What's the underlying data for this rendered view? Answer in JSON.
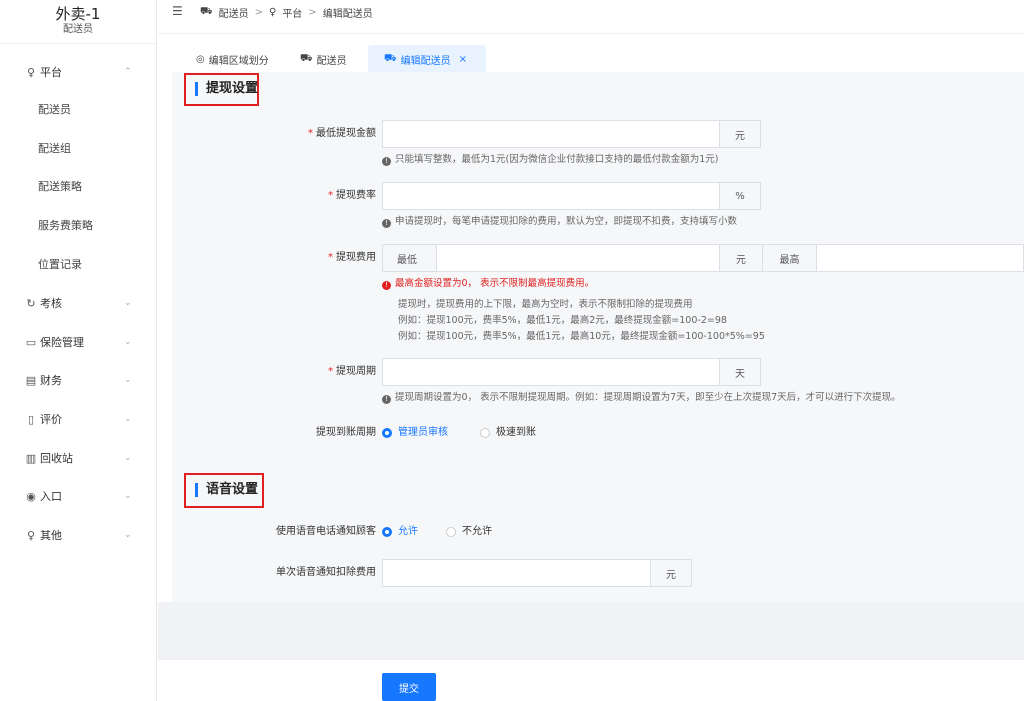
{
  "brand": {
    "title": "外卖-1",
    "subtitle": "配送员"
  },
  "sidebar": {
    "groups": [
      {
        "label": "平台",
        "icon": "people-icon",
        "glyph": "♀",
        "chev": "⌃"
      },
      {
        "label": "考核",
        "icon": "sync-icon",
        "glyph": "↻",
        "chev": "⌄"
      },
      {
        "label": "保险管理",
        "icon": "monitor-icon",
        "glyph": "▭",
        "chev": "⌄"
      },
      {
        "label": "财务",
        "icon": "ledger-icon",
        "glyph": "▤",
        "chev": "⌄"
      },
      {
        "label": "评价",
        "icon": "document-icon",
        "glyph": "▯",
        "chev": "⌄"
      },
      {
        "label": "回收站",
        "icon": "trash-icon",
        "glyph": "▥",
        "chev": "⌄"
      },
      {
        "label": "入口",
        "icon": "target-icon",
        "glyph": "◉",
        "chev": "⌄"
      },
      {
        "label": "其他",
        "icon": "user-icon",
        "glyph": "♀",
        "chev": "⌄"
      }
    ],
    "subitems": [
      "配送员",
      "配送组",
      "配送策略",
      "服务费策略",
      "位置记录"
    ]
  },
  "topbar": {
    "fold_glyph": "☰",
    "crumbs": [
      "配送员",
      "平台",
      "编辑配送员"
    ]
  },
  "tabs": [
    {
      "label": "编辑区域划分",
      "glyph": "◎"
    },
    {
      "label": "配送员",
      "glyph": "⛟"
    },
    {
      "label": "编辑配送员",
      "glyph": "⛟",
      "close": "×"
    }
  ],
  "withdraw": {
    "title": "提现设置",
    "min_amount": {
      "label": "最低提现金额",
      "unit": "元",
      "hint": "只能填写整数，最低为1元(因为微信企业付款接口支持的最低付款金额为1元)"
    },
    "fee_rate": {
      "label": "提现费率",
      "unit": "%",
      "hint": "申请提现时，每笔申请提现扣除的费用，默认为空，即提现不扣费，支持填写小数"
    },
    "fee": {
      "label": "提现费用",
      "min_label": "最低",
      "unit": "元",
      "max_label": "最高",
      "error": "最高金额设置为0，  表示不限制最高提现费用。",
      "hint1": "提现时，提现费用的上下限，最高为空时，表示不限制扣除的提现费用",
      "hint2": "例如：提现100元，费率5%，最低1元，最高2元，最终提现金额=100-2=98",
      "hint3": "例如：提现100元，费率5%，最低1元，最高10元，最终提现金额=100-100*5%=95"
    },
    "period": {
      "label": "提现周期",
      "unit": "天",
      "hint": "提现周期设置为0，  表示不限制提现周期。例如：提现周期设置为7天，即至少在上次提现7天后，才可以进行下次提现。"
    },
    "arrival": {
      "label": "提现到账周期",
      "options": [
        "管理员审核",
        "极速到账"
      ],
      "selected": "管理员审核"
    }
  },
  "voice": {
    "title": "语音设置",
    "notify": {
      "label": "使用语音电话通知顾客",
      "options": [
        "允许",
        "不允许"
      ],
      "selected": "允许"
    },
    "fee": {
      "label": "单次语音通知扣除费用",
      "unit": "元"
    }
  },
  "submit_label": "提交",
  "colors": {
    "primary": "#1677ff",
    "danger": "#e02020"
  }
}
